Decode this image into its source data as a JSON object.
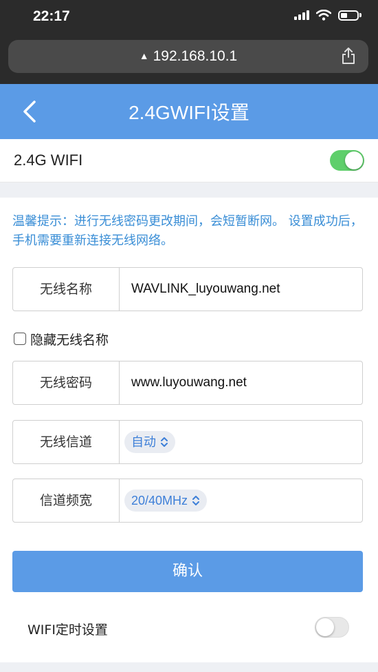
{
  "status_bar": {
    "time": "22:17"
  },
  "browser": {
    "url": "192.168.10.1"
  },
  "header": {
    "title": "2.4GWIFI设置"
  },
  "wifi_toggle": {
    "label": "2.4G WIFI",
    "enabled": true
  },
  "tip": {
    "text": "温馨提示：进行无线密码更改期间，会短暂断网。 设置成功后，手机需要重新连接无线网络。"
  },
  "ssid": {
    "label": "无线名称",
    "value": "WAVLINK_luyouwang.net"
  },
  "hide_ssid": {
    "label": "隐藏无线名称",
    "checked": false
  },
  "password": {
    "label": "无线密码",
    "value": "www.luyouwang.net"
  },
  "channel": {
    "label": "无线信道",
    "selected": "自动"
  },
  "bandwidth": {
    "label": "信道频宽",
    "selected": "20/40MHz"
  },
  "confirm_button": {
    "label": "确认"
  },
  "wifi_timer": {
    "label": "WIFI定时设置",
    "enabled": false
  },
  "colors": {
    "accent": "#5b9be6",
    "toggle_on": "#5fcf6b",
    "tip": "#3a8ed6"
  }
}
